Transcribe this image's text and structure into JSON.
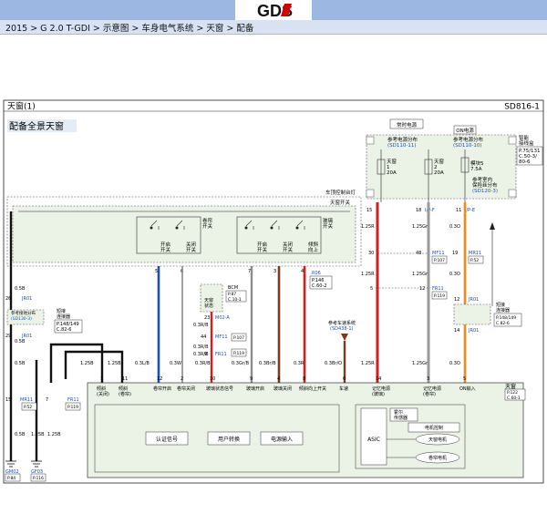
{
  "header": {
    "logo_text": "GDS",
    "breadcrumb": "2015 > G 2.0 T-GDI > 示意图 > 车身电气系统 > 天窗 > 配备"
  },
  "sheet": {
    "title": "天窗(1)",
    "code": "SD816-1",
    "subtitle": "配备全景天窗"
  },
  "fuse_box": {
    "always_label": "常时电源",
    "on_label": "ON电源",
    "ref1": "参考电源分布",
    "ref1_code": "(SD110-11)",
    "ref2": "参考电源分布",
    "ref2_code": "(SD110-10)",
    "fuse1": [
      "天窗",
      "1",
      "20A"
    ],
    "fuse2": [
      "天窗",
      "2",
      "20A"
    ],
    "fuse3": [
      "模块5",
      "7.5A"
    ],
    "ref3": "参考室内",
    "ref3b": "保险丝分布",
    "ref3_code": "(SD120-3)",
    "side_label1": "智能",
    "side_label2": "接线盒",
    "side_ref": [
      "P.75/131",
      "C.50-3/",
      "80-6"
    ]
  },
  "overhead": {
    "title": "车顶控制台灯",
    "switch_title": "天窗开关",
    "left_label": [
      "卷帘",
      "开关"
    ],
    "right_label": [
      "玻璃",
      "开关"
    ],
    "left_switches": [
      "开启",
      "开关",
      "关闭",
      "开关"
    ],
    "right_switches": [
      "开启",
      "开关",
      "关闭",
      "开关",
      "倾斜",
      "向上"
    ]
  },
  "connectors": {
    "R06": "R06",
    "R06_ref": [
      "P.146",
      "C.60-2"
    ],
    "MF11": "MF11",
    "MF11_ref": "P.107",
    "FR11": "FR11",
    "FR11_ref": "P.119",
    "MR11": "MR11",
    "MR11_ref": "P.52",
    "JR01": "JR01",
    "bcm": [
      "BCM",
      "P.87",
      "C.10-1"
    ],
    "bcm_box": [
      "天窗",
      "状态"
    ],
    "M02A": "M02-A",
    "short_left_label1": "短接",
    "short_left_label2": "连接器",
    "short_left_ref": [
      "P.148/149",
      "C.82-6"
    ],
    "short_right_label1": "短接",
    "short_right_label2": "连接器",
    "short_right_ref": [
      "P.148/149",
      "C.82-6"
    ],
    "ref_ground": "参考接地分布",
    "ref_ground_code": "(SD130-3)",
    "ref_body": "参考车速系统",
    "ref_body_code": "(SD438-1)",
    "GM02": "GM02",
    "GM02_ref": "P.84",
    "GF03": "GF03",
    "GF03_ref": "P.116",
    "FR11_b": "FR11",
    "FR11_b_ref": "P.119",
    "MR11_b": "MR11",
    "MR11_b_ref": "P.52",
    "R05": "R05"
  },
  "wires": {
    "w1": "0.5B",
    "w2": "0.5B",
    "w3": "0.5B",
    "w4": "1.25B",
    "w5": "1.25B",
    "w6": "1.25B",
    "w7": "0.3L/B",
    "w8": "0.3W",
    "w9": "0.3R/B",
    "w10": "0.3Gr/B",
    "w11": "0.3Br/B",
    "w12": "0.3R",
    "w13": "0.3Br/O",
    "w14": "1.25R",
    "w15": "1.25Gr",
    "w16": "0.3O",
    "w17": "1.25R",
    "w18": "1.25Gr",
    "w19": "0.3O",
    "w20": "1.25R",
    "w21": "1.25Gr",
    "w22": "0.3O",
    "w23": "0.3R/B",
    "w24": "0.3R/B",
    "w25": "0.3R/B"
  },
  "module": {
    "title": "天窗",
    "ref": [
      "P.122",
      "C.60-1"
    ],
    "inputs": [
      "倾斜(关闭)",
      "倾斜(卷帘)",
      "卷帘开启",
      "卷帘关闭",
      "玻璃状态信号",
      "玻璃开启",
      "玻璃关闭",
      "倾斜向上开关",
      "车速",
      "记忆电源(玻璃)",
      "记忆电源(卷帘)",
      "ON输入"
    ],
    "pins": [
      "1",
      "11",
      "12",
      "2",
      "10",
      "9",
      "4",
      "8",
      "6",
      "14",
      "3",
      "5"
    ],
    "blocks": [
      "认证信号",
      "用户转换",
      "电源输入"
    ],
    "asic": "ASIC",
    "hall": [
      "霍尔",
      "传感器"
    ],
    "motor_ctrl": "电机控制",
    "motor1": "天窗电机",
    "motor2": "卷帘电机"
  }
}
